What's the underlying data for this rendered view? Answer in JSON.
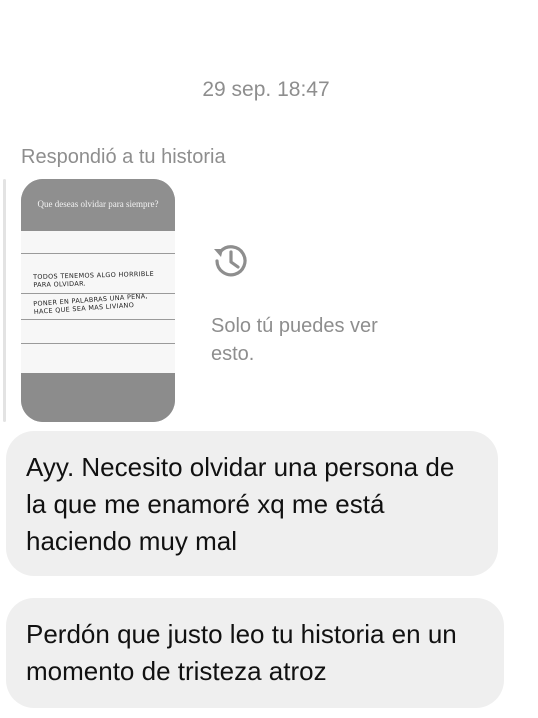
{
  "conversation": {
    "timestamp": "29 sep. 18:47",
    "reply_label": "Respondió a tu historia",
    "story": {
      "question": "Que deseas olvidar para siempre?",
      "paper_line_1a": "TODOS TENEMOS ALGO HORRIBLE",
      "paper_line_1b": "PARA OLVIDAR.",
      "paper_line_2a": "PONER EN PALABRAS UNA PENA,",
      "paper_line_2b": "HACE QUE SEA MAS LIVIANO"
    },
    "private_note_icon": "history-icon",
    "private_note": "Solo tú puedes ver esto.",
    "messages": [
      {
        "text": "Ayy. Necesito olvidar una persona de la que me enamoré xq me está haciendo muy mal"
      },
      {
        "text": "Perdón que justo leo tu historia en un momento de tristeza atroz"
      }
    ]
  },
  "colors": {
    "background": "#ffffff",
    "secondary_text": "#8e8e8e",
    "bubble": "#efefef",
    "message_text": "#111111"
  }
}
